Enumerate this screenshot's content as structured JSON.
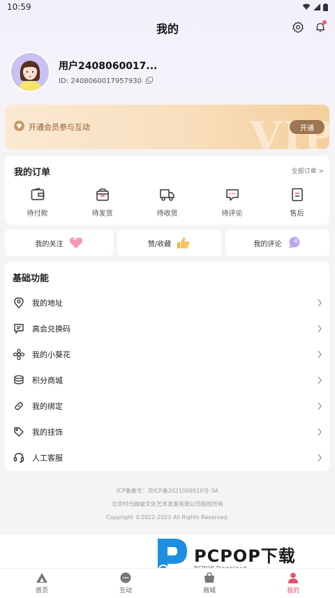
{
  "status_bar": {
    "time": "10:59"
  },
  "header": {
    "title": "我的"
  },
  "profile": {
    "username": "用户2408060017...",
    "id_label": "ID: 2408060017957930"
  },
  "vip": {
    "text": "开通会员参与互动",
    "button": "开通",
    "watermark": "VIP"
  },
  "orders": {
    "title": "我的订单",
    "all_link": "全部订单 >",
    "items": [
      {
        "label": "待付款",
        "icon": "wallet-icon"
      },
      {
        "label": "待发货",
        "icon": "package-icon"
      },
      {
        "label": "待收货",
        "icon": "truck-icon"
      },
      {
        "label": "待评论",
        "icon": "comment-icon"
      },
      {
        "label": "售后",
        "icon": "after-sales-icon"
      }
    ]
  },
  "quick_links": [
    {
      "label": "我的关注",
      "icon": "heart-icon"
    },
    {
      "label": "赞/收藏",
      "icon": "thumbs-up-icon"
    },
    {
      "label": "我的评论",
      "icon": "comment-bubble-icon"
    }
  ],
  "functions": {
    "title": "基础功能",
    "items": [
      {
        "label": "我的地址",
        "icon": "location-icon"
      },
      {
        "label": "高会兑换码",
        "icon": "coupon-icon"
      },
      {
        "label": "我的小葵花",
        "icon": "flower-icon"
      },
      {
        "label": "积分商城",
        "icon": "coins-icon"
      },
      {
        "label": "我的绑定",
        "icon": "link-icon"
      },
      {
        "label": "我的挂饰",
        "icon": "tag-icon"
      },
      {
        "label": "人工客服",
        "icon": "headset-icon"
      }
    ]
  },
  "footer": {
    "line1": "ICP备案号：京ICP备2021009510号-3A",
    "line2": "北京时代峰峻文化艺术发展有限公司版权所有",
    "line3": "Copyright ©2022-2023 All Rights Reserved."
  },
  "watermark": {
    "main": "PCPOP下载",
    "sub": "PCPOP Download"
  },
  "tabbar": {
    "tabs": [
      {
        "label": "首页",
        "icon": "home-icon"
      },
      {
        "label": "互动",
        "icon": "chat-icon"
      },
      {
        "label": "商城",
        "icon": "shop-bag-icon"
      },
      {
        "label": "我的",
        "icon": "person-icon",
        "active": true
      }
    ]
  },
  "colors": {
    "accent": "#e8506a",
    "vip_button": "#9c7651",
    "vip_text": "#8c5c2e"
  }
}
